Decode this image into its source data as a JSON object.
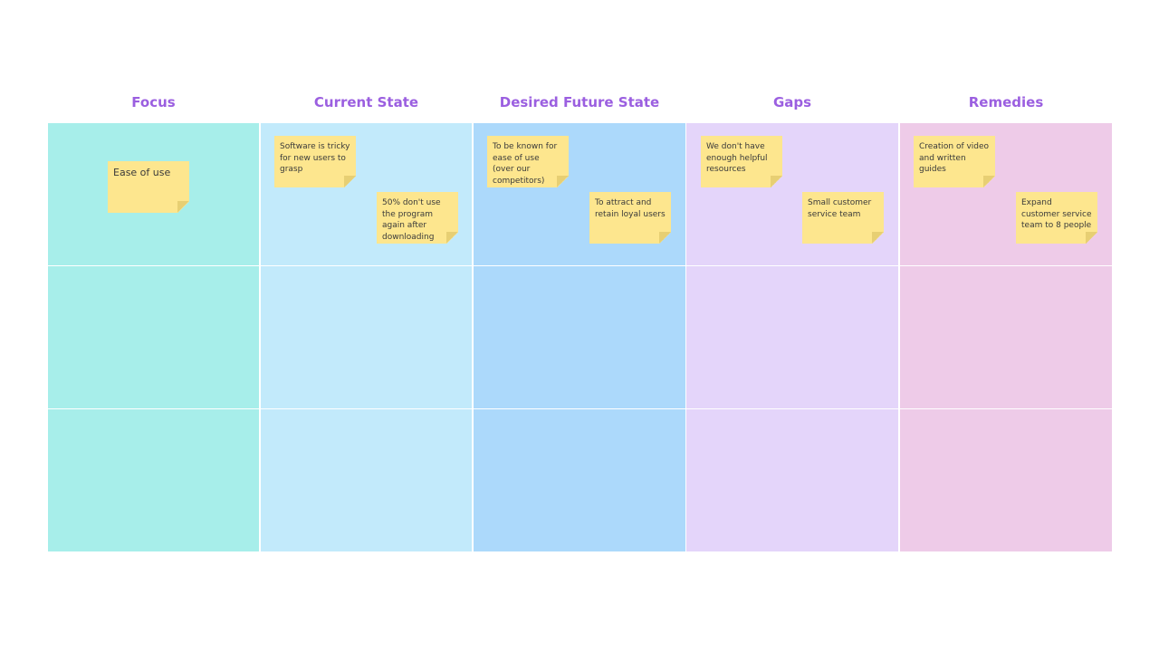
{
  "board": {
    "columns": [
      {
        "title": "Focus",
        "color": "#a7eeea"
      },
      {
        "title": "Current State",
        "color": "#c2eafb"
      },
      {
        "title": "Desired Future State",
        "color": "#acd9fb"
      },
      {
        "title": "Gaps",
        "color": "#e4d5fa"
      },
      {
        "title": "Remedies",
        "color": "#eecbe8"
      }
    ],
    "rows": 3,
    "stickies": {
      "focus": [
        "Ease of use"
      ],
      "current_state": [
        "Software is tricky for new users to grasp",
        "50% don't use the program again after downloading"
      ],
      "desired_future_state": [
        "To be known for ease of use (over our competitors)",
        "To attract and retain loyal users"
      ],
      "gaps": [
        "We don't have enough helpful resources",
        "Small customer service team"
      ],
      "remedies": [
        "Creation of video and written guides",
        "Expand customer service team to 8 people"
      ]
    },
    "sticky_color": "#fde68e"
  }
}
